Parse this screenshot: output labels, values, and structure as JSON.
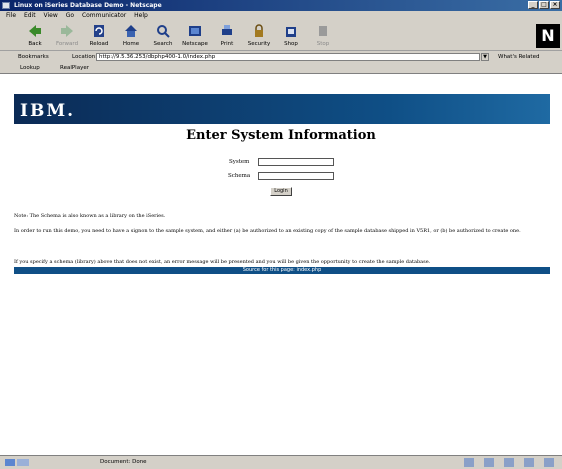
{
  "window": {
    "title": "Linux on iSeries Database Demo - Netscape"
  },
  "menu": [
    "File",
    "Edit",
    "View",
    "Go",
    "Communicator",
    "Help"
  ],
  "toolbar": {
    "back": "Back",
    "forward": "Forward",
    "reload": "Reload",
    "home": "Home",
    "search": "Search",
    "netscape": "Netscape",
    "print": "Print",
    "security": "Security",
    "shop": "Shop",
    "stop": "Stop"
  },
  "location": {
    "bookmarks": "Bookmarks",
    "label": "Location:",
    "url": "http://9.5.36.253/dbphp400-1.0/index.php",
    "related": "What's Related"
  },
  "personal": {
    "lookup": "Lookup",
    "realplayer": "RealPlayer"
  },
  "page": {
    "logo": "IBM.",
    "heading": "Enter System Information",
    "system_label": "System",
    "schema_label": "Schema",
    "login_button": "Login",
    "note": "Note: The Schema is also known as a library on the iSeries.",
    "para1": "In order to run this demo, you need to have a signon to the sample system, and either (a) be authorized to an existing copy of the sample database shipped in V5R1, or (b) be authorized to create one.",
    "para2": "If you specify a schema (library) above that does not exist, an error message will be presented and you will be given the opportunity to create the sample database.",
    "source_prefix": "Source for this page:",
    "source_link": "index.php"
  },
  "status": {
    "text": "Document: Done"
  }
}
